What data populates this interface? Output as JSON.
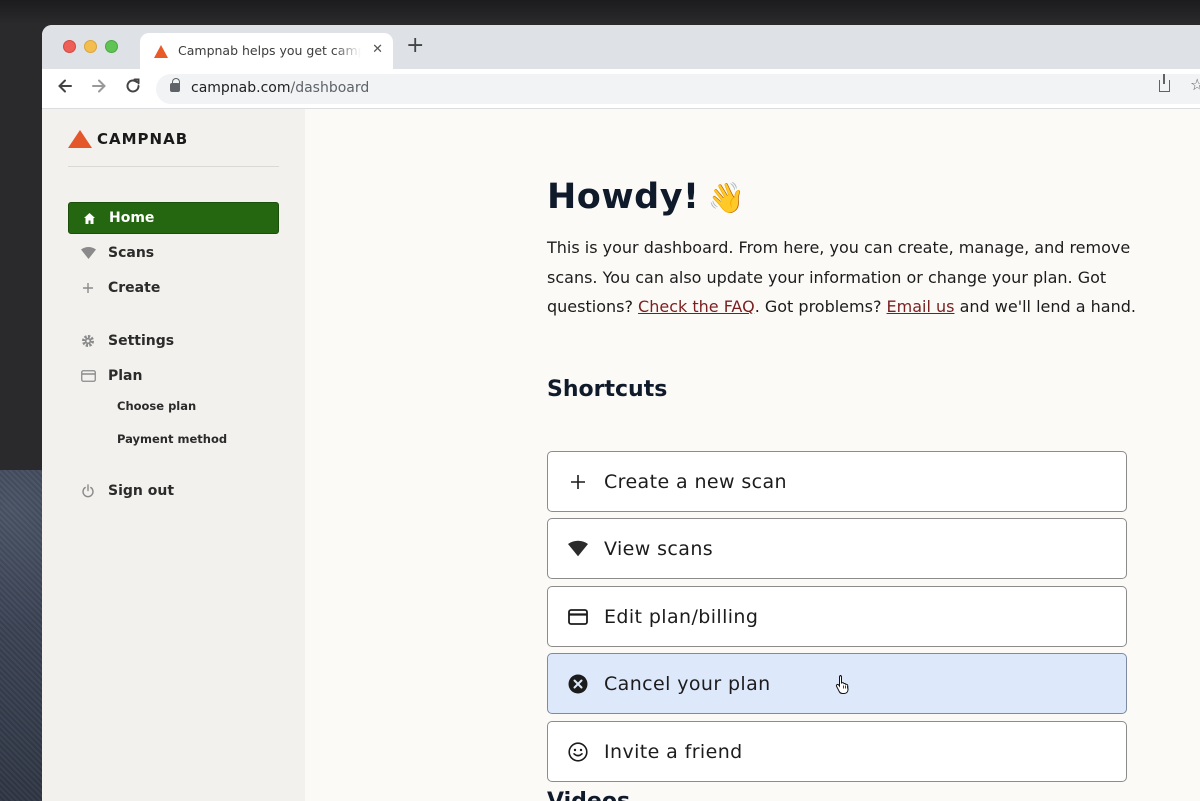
{
  "browser": {
    "tab_title": "Campnab helps you get campsites",
    "tab_close": "✕",
    "new_tab": "+",
    "url_host": "campnab.com",
    "url_path": "/dashboard"
  },
  "sidebar": {
    "brand": "CAMPNAB",
    "items": [
      {
        "label": "Home",
        "icon": "home-icon"
      },
      {
        "label": "Scans",
        "icon": "wifi-icon"
      },
      {
        "label": "Create",
        "icon": "plus-icon"
      },
      {
        "label": "Settings",
        "icon": "gear-icon"
      },
      {
        "label": "Plan",
        "icon": "credit-card-icon"
      },
      {
        "label": "Sign out",
        "icon": "power-icon"
      }
    ],
    "plan_subitems": [
      "Choose plan",
      "Payment method"
    ]
  },
  "main": {
    "greeting": "Howdy!",
    "greeting_emoji": "👋",
    "intro_part1": "This is your dashboard. From here, you can create, manage, and remove scans. You can also update your information or change your plan. Got questions? ",
    "faq_link": "Check the FAQ",
    "intro_part2": ". Got problems? ",
    "email_link": "Email us",
    "intro_part3": " and we'll lend a hand.",
    "shortcuts_heading": "Shortcuts",
    "shortcuts": [
      {
        "label": "Create a new scan",
        "icon": "plus-icon"
      },
      {
        "label": "View scans",
        "icon": "wifi-icon"
      },
      {
        "label": "Edit plan/billing",
        "icon": "credit-card-icon"
      },
      {
        "label": "Cancel your plan",
        "icon": "cancel-circle-icon",
        "hovered": true
      },
      {
        "label": "Invite a friend",
        "icon": "smiley-icon"
      }
    ],
    "videos_heading": "Videos"
  },
  "colors": {
    "active_nav": "#256610",
    "brand_logo": "#e3572a",
    "hover_shortcut": "#dde9fb"
  }
}
